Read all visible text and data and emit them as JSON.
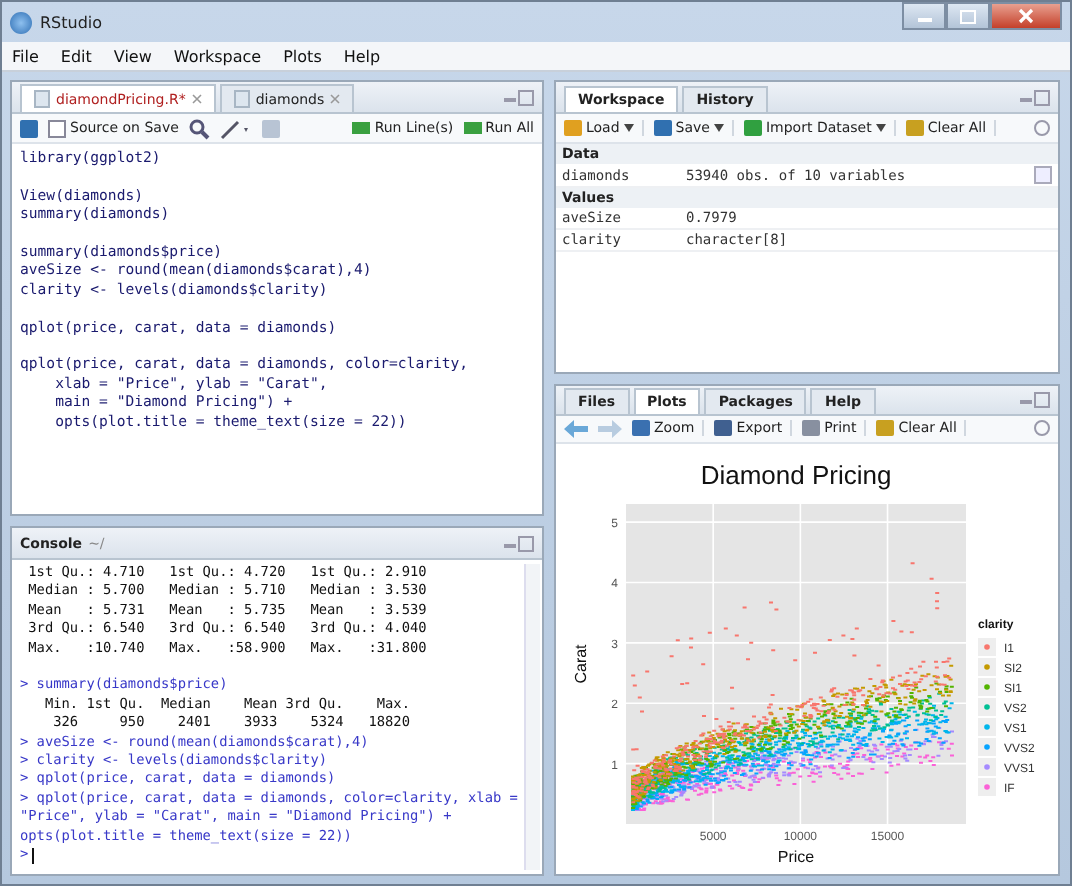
{
  "window": {
    "title": "RStudio"
  },
  "menu": [
    "File",
    "Edit",
    "View",
    "Workspace",
    "Plots",
    "Help"
  ],
  "editor": {
    "tabs": [
      {
        "label": "diamondPricing.R*",
        "selected": true,
        "modified": true
      },
      {
        "label": "diamonds",
        "selected": false,
        "modified": false
      }
    ],
    "source_on_save": {
      "label": "Source on Save",
      "checked": false
    },
    "run_buttons": [
      "Run Line(s)",
      "Run All"
    ],
    "lines": [
      {
        "kind": "code",
        "text": "library(ggplot2)"
      },
      {
        "kind": "blank"
      },
      {
        "kind": "code",
        "text": "View(diamonds)"
      },
      {
        "kind": "code",
        "text": "summary(diamonds)"
      },
      {
        "kind": "blank"
      },
      {
        "kind": "code",
        "text": "summary(diamonds$price)"
      },
      {
        "kind": "code",
        "text": "aveSize <- round(mean(diamonds$carat),4)"
      },
      {
        "kind": "code",
        "text": "clarity <- levels(diamonds$clarity)"
      },
      {
        "kind": "blank"
      },
      {
        "kind": "code",
        "text": "qplot(price, carat, data = diamonds)"
      },
      {
        "kind": "blank"
      },
      {
        "kind": "code",
        "text": "qplot(price, carat, data = diamonds, color=clarity,"
      },
      {
        "kind": "code",
        "text": "    xlab = \"Price\", ylab = \"Carat\","
      },
      {
        "kind": "code",
        "text": "    main = \"Diamond Pricing\") +"
      },
      {
        "kind": "code",
        "text": "    opts(plot.title = theme_text(size = 22))"
      }
    ]
  },
  "console": {
    "title": "Console",
    "path": "~/",
    "lines": [
      {
        "kind": "output",
        "text": " 1st Qu.: 4.710   1st Qu.: 4.720   1st Qu.: 2.910"
      },
      {
        "kind": "output",
        "text": " Median : 5.700   Median : 5.710   Median : 3.530"
      },
      {
        "kind": "output",
        "text": " Mean   : 5.731   Mean   : 5.735   Mean   : 3.539"
      },
      {
        "kind": "output",
        "text": " 3rd Qu.: 6.540   3rd Qu.: 6.540   3rd Qu.: 4.040"
      },
      {
        "kind": "output",
        "text": " Max.   :10.740   Max.   :58.900   Max.   :31.800"
      },
      {
        "kind": "blank"
      },
      {
        "kind": "input",
        "text": "> summary(diamonds$price)"
      },
      {
        "kind": "output",
        "text": "   Min. 1st Qu.  Median    Mean 3rd Qu.    Max."
      },
      {
        "kind": "output",
        "text": "    326     950    2401    3933    5324   18820"
      },
      {
        "kind": "input",
        "text": "> aveSize <- round(mean(diamonds$carat),4)"
      },
      {
        "kind": "input",
        "text": "> clarity <- levels(diamonds$clarity)"
      },
      {
        "kind": "input",
        "text": "> qplot(price, carat, data = diamonds)"
      },
      {
        "kind": "input",
        "text": "> qplot(price, carat, data = diamonds, color=clarity, xlab ="
      },
      {
        "kind": "input",
        "text": "\"Price\", ylab = \"Carat\", main = \"Diamond Pricing\") +"
      },
      {
        "kind": "input",
        "text": "opts(plot.title = theme_text(size = 22))"
      },
      {
        "kind": "prompt",
        "text": ">"
      }
    ]
  },
  "workspace": {
    "tabs": [
      {
        "label": "Workspace",
        "selected": true
      },
      {
        "label": "History",
        "selected": false
      }
    ],
    "toolbar": [
      {
        "kind": "load",
        "label": "Load",
        "dropdown": true
      },
      {
        "kind": "save",
        "label": "Save",
        "dropdown": true
      },
      {
        "kind": "import",
        "label": "Import Dataset",
        "dropdown": true
      },
      {
        "kind": "clear",
        "label": "Clear All",
        "dropdown": false
      }
    ],
    "sections": [
      {
        "title": "Data",
        "rows": [
          {
            "name": "diamonds",
            "value": "53940 obs. of 10 variables",
            "viewable": true
          }
        ]
      },
      {
        "title": "Values",
        "rows": [
          {
            "name": "aveSize",
            "value": "0.7979",
            "viewable": false
          },
          {
            "name": "clarity",
            "value": "character[8]",
            "viewable": false
          }
        ]
      }
    ]
  },
  "files": {
    "tabs": [
      {
        "label": "Files",
        "selected": false
      },
      {
        "label": "Plots",
        "selected": true
      },
      {
        "label": "Packages",
        "selected": false
      },
      {
        "label": "Help",
        "selected": false
      }
    ],
    "toolbar": [
      {
        "kind": "zoom",
        "label": "Zoom"
      },
      {
        "kind": "export",
        "label": "Export"
      },
      {
        "kind": "print",
        "label": "Print"
      },
      {
        "kind": "clear",
        "label": "Clear All"
      }
    ],
    "plot": {
      "title": "Diamond Pricing",
      "xlabel": "Price",
      "ylabel": "Carat",
      "xticks": [
        "5000",
        "10000",
        "15000"
      ],
      "yticks": [
        "5",
        "4",
        "3",
        "2",
        "1"
      ],
      "legend_title": "clarity",
      "legend": [
        {
          "label": "I1",
          "color": "#f8766d"
        },
        {
          "label": "SI2",
          "color": "#c49a00"
        },
        {
          "label": "SI1",
          "color": "#53b400"
        },
        {
          "label": "VS2",
          "color": "#00c094"
        },
        {
          "label": "VS1",
          "color": "#00b6eb"
        },
        {
          "label": "VVS2",
          "color": "#06a4ff"
        },
        {
          "label": "VVS1",
          "color": "#a58aff"
        },
        {
          "label": "IF",
          "color": "#fb61d7"
        }
      ]
    }
  }
}
